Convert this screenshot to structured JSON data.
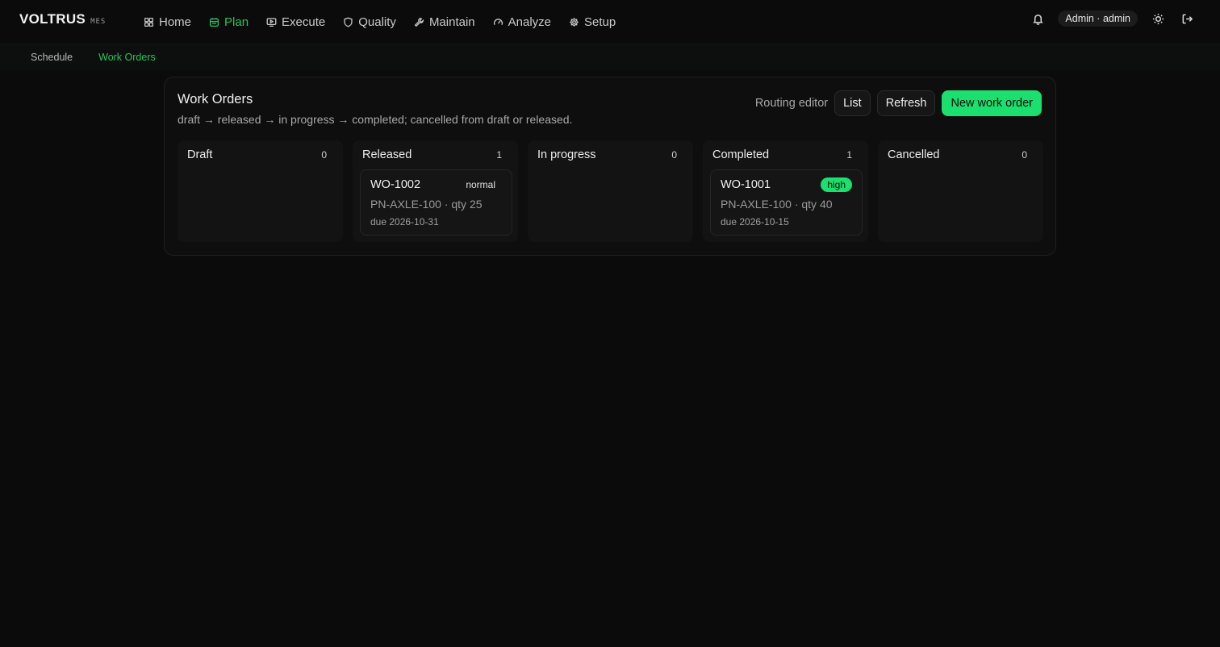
{
  "brand": {
    "name": "VOLTRUS",
    "sub": "MES"
  },
  "nav": {
    "items": [
      {
        "label": "Home",
        "icon": "grid-icon"
      },
      {
        "label": "Plan",
        "icon": "calendar-icon",
        "active": true
      },
      {
        "label": "Execute",
        "icon": "monitor-play-icon"
      },
      {
        "label": "Quality",
        "icon": "shield-icon"
      },
      {
        "label": "Maintain",
        "icon": "wrench-icon"
      },
      {
        "label": "Analyze",
        "icon": "gauge-icon"
      },
      {
        "label": "Setup",
        "icon": "gear-icon"
      }
    ],
    "user": "Admin · admin"
  },
  "subnav": {
    "items": [
      "Schedule",
      "Work Orders"
    ],
    "active": "Work Orders"
  },
  "panel": {
    "title": "Work Orders",
    "subtitle": "draft → released → in progress → completed; cancelled from draft or released.",
    "routing_editor": "Routing editor",
    "list": "List",
    "refresh": "Refresh",
    "new": "New work order"
  },
  "columns": [
    {
      "title": "Draft",
      "count": "0",
      "cards": []
    },
    {
      "title": "Released",
      "count": "1",
      "cards": [
        {
          "id": "WO-1002",
          "priority": "normal",
          "part": "PN-AXLE-100 · qty 25",
          "due": "due 2026-10-31"
        }
      ]
    },
    {
      "title": "In progress",
      "count": "0",
      "cards": []
    },
    {
      "title": "Completed",
      "count": "1",
      "cards": [
        {
          "id": "WO-1001",
          "priority": "high",
          "part": "PN-AXLE-100 · qty 40",
          "due": "due 2026-10-15"
        }
      ]
    },
    {
      "title": "Cancelled",
      "count": "0",
      "cards": []
    }
  ],
  "colors": {
    "accent": "#1bdf6e",
    "background": "#0b0b0b"
  }
}
